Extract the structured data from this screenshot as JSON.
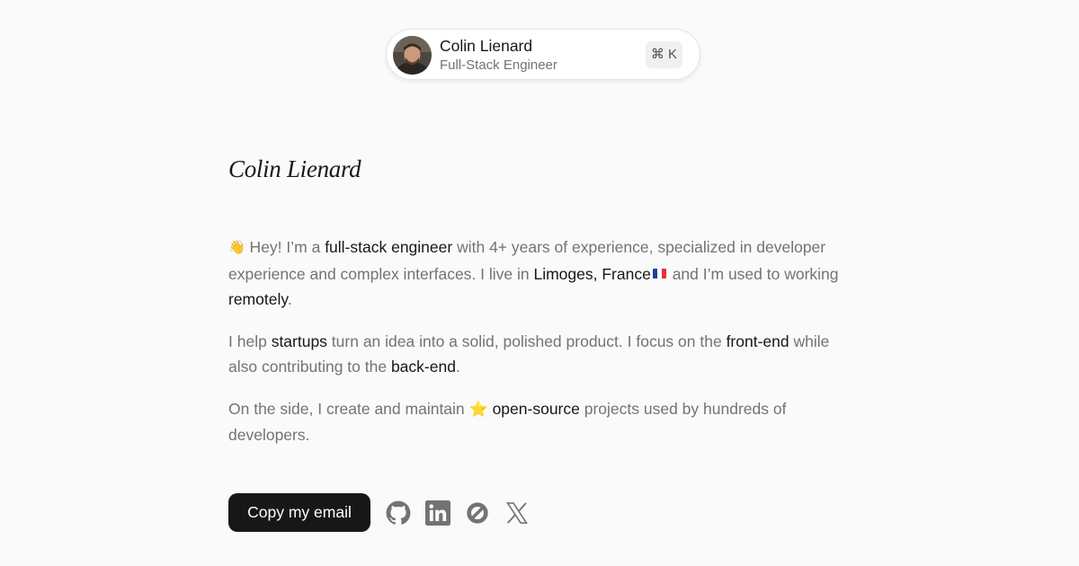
{
  "profile": {
    "name": "Colin Lienard",
    "role": "Full-Stack Engineer",
    "shortcut": "⌘ K",
    "avatar_icon": "person-photo"
  },
  "title": "Colin Lienard",
  "bio": {
    "p1": {
      "wave_emoji": "👋",
      "t1": " Hey! I’m a ",
      "h1": "full-stack engineer",
      "t2": " with 4+ years of experience, specialized in developer experience and complex interfaces. I live in ",
      "h2": "Limoges, France",
      "flag_icon": "france-flag",
      "t3": " and I’m used to working ",
      "h3": "remotely",
      "t4": "."
    },
    "p2": {
      "t1": "I help ",
      "h1": "startups",
      "t2": " turn an idea into a solid, polished product. I focus on the ",
      "h2": "front-end",
      "t3": " while also contributing to the ",
      "h3": "back-end",
      "t4": "."
    },
    "p3": {
      "t1": "On the side, I create and maintain ",
      "star_emoji": "⭐",
      "h1": "open-source",
      "t2": " projects used by hundreds of developers."
    }
  },
  "actions": {
    "copy_email_label": "Copy my email",
    "social_icons": [
      "github-icon",
      "linkedin-icon",
      "codeberg-icon",
      "x-icon"
    ]
  },
  "colors": {
    "background": "#fafafa",
    "text_primary": "#171717",
    "text_muted": "#737373",
    "button_bg": "#171717"
  }
}
